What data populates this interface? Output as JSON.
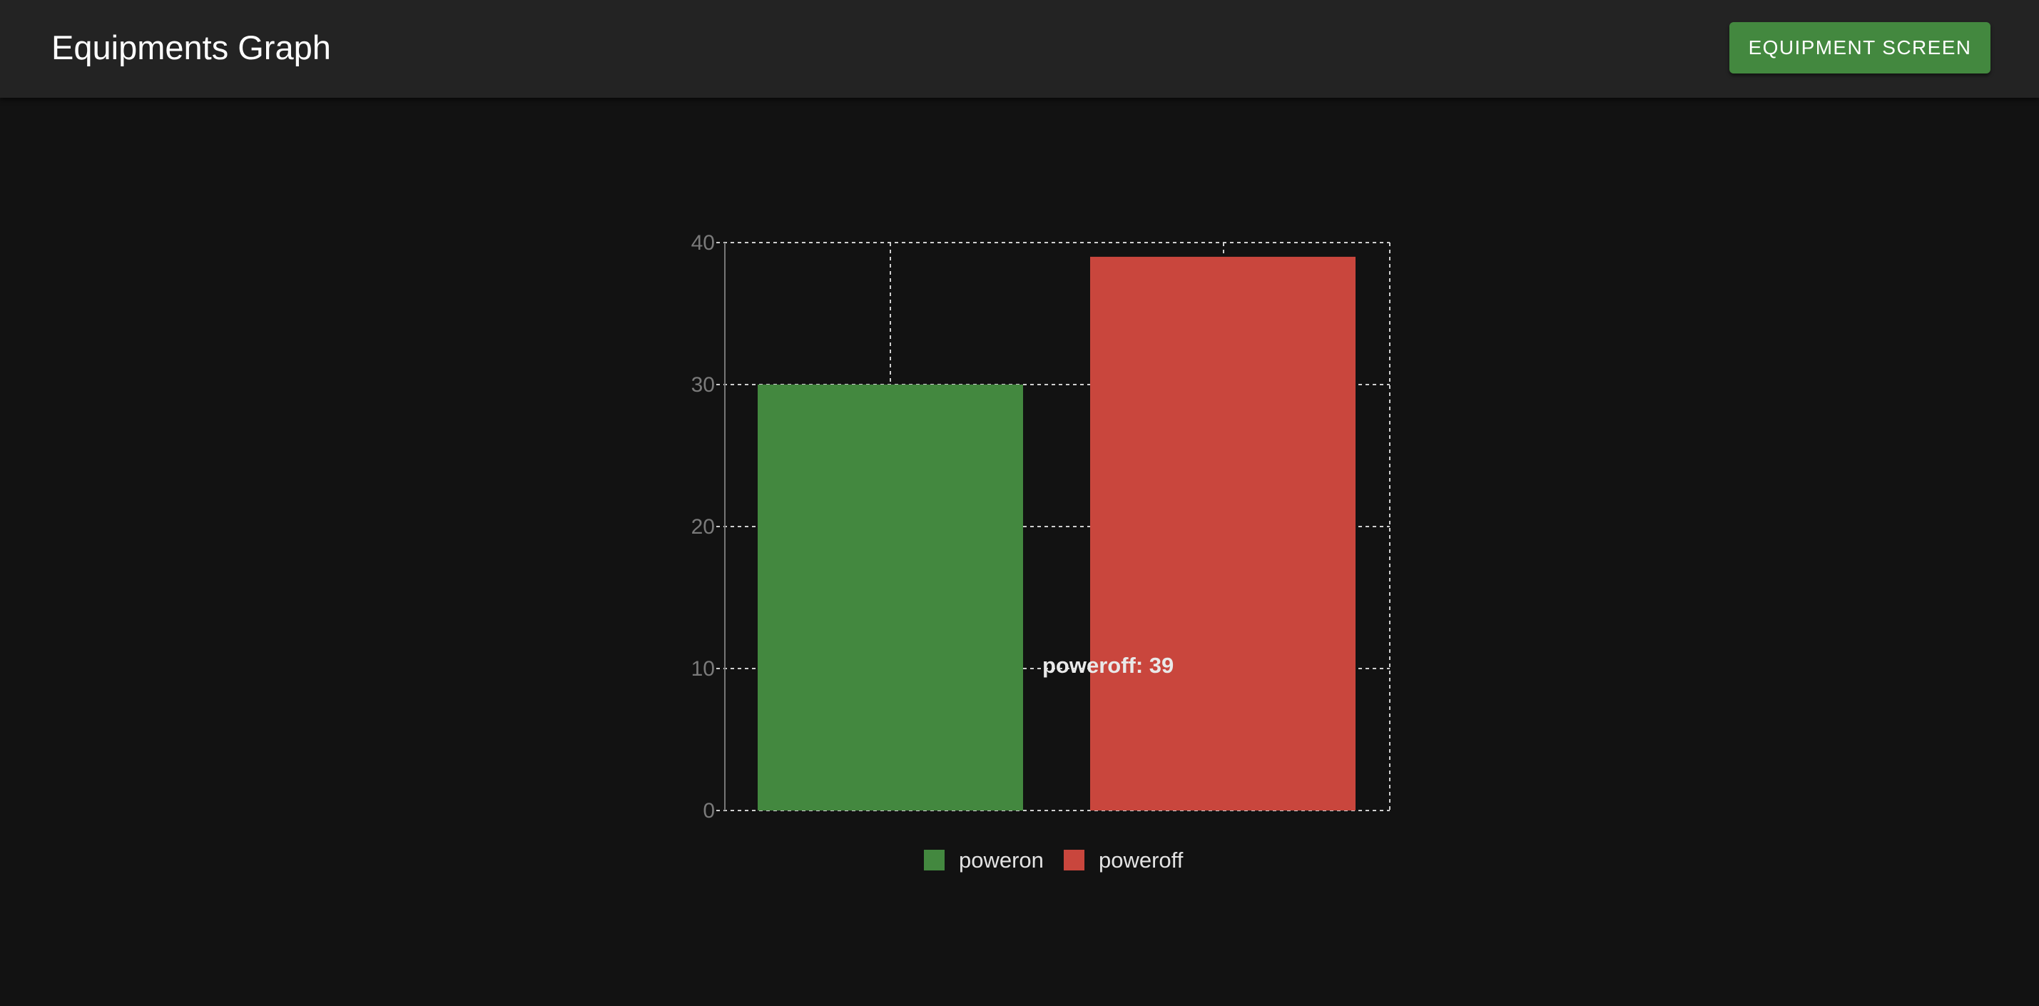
{
  "header": {
    "title": "Equipments Graph",
    "nav_button_label": "EQUIPMENT SCREEN"
  },
  "colors": {
    "page_background": "#121212",
    "appbar_background": "#232323",
    "button_background": "#43883f",
    "poweron": "#43883f",
    "poweroff": "#c9463d"
  },
  "chart_data": {
    "type": "bar",
    "categories": [
      ""
    ],
    "series": [
      {
        "name": "poweron",
        "values": [
          30
        ],
        "color": "#43883f"
      },
      {
        "name": "poweroff",
        "values": [
          39
        ],
        "color": "#c9463d"
      }
    ],
    "title": "",
    "xlabel": "",
    "ylabel": "",
    "ylim": [
      0,
      40
    ],
    "yticks": [
      0,
      10,
      20,
      30,
      40
    ],
    "grid": true,
    "legend": "bottom",
    "tooltip": {
      "series": "poweroff",
      "value": 39,
      "text": "poweroff: 39"
    }
  }
}
